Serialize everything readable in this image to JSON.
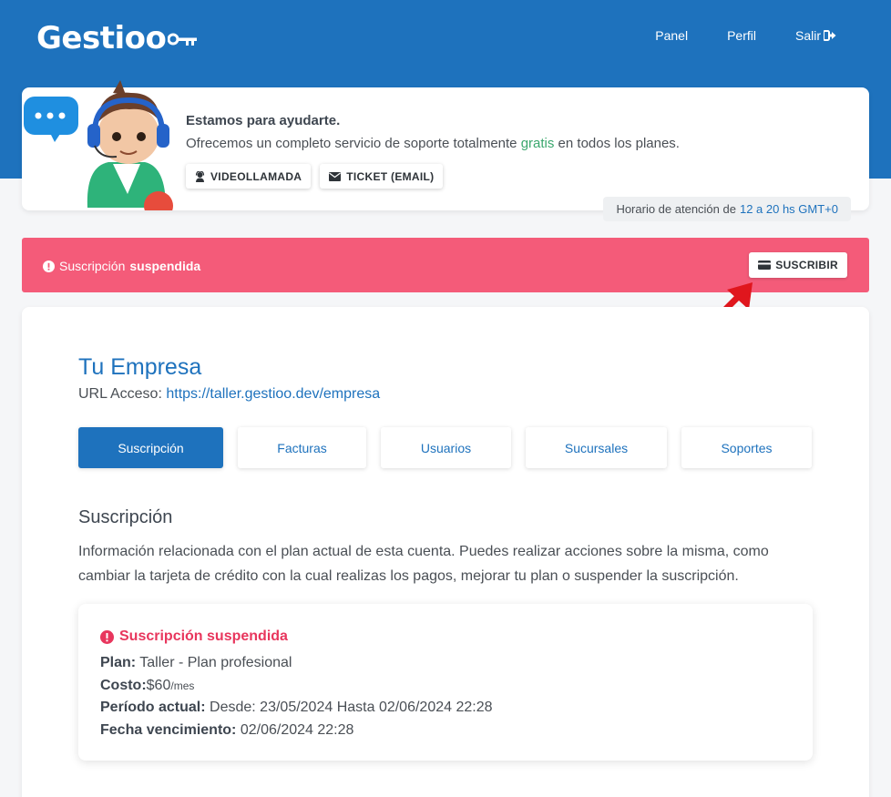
{
  "brand": {
    "logo": "Gestioo"
  },
  "nav": {
    "panel": "Panel",
    "profile": "Perfil",
    "logout": "Salir"
  },
  "help": {
    "title": "Estamos para ayudarte.",
    "desc_before": "Ofrecemos un completo servicio de soporte totalmente",
    "desc_highlight": "gratis",
    "desc_after": "en todos los planes.",
    "video_button": "VIDEOLLAMADA",
    "ticket_button": "TICKET (EMAIL)",
    "hours_label": "Horario de atención de",
    "hours_value": "12 a 20 hs GMT+0"
  },
  "alert": {
    "prefix": "Suscripción",
    "status": "suspendida",
    "subscribe_button": "SUSCRIBIR"
  },
  "company": {
    "name": "Tu Empresa",
    "url_label": "URL Acceso:",
    "url": "https://taller.gestioo.dev/empresa"
  },
  "tabs": [
    "Suscripción",
    "Facturas",
    "Usuarios",
    "Sucursales",
    "Soportes"
  ],
  "section": {
    "title": "Suscripción",
    "desc_line1": "Información relacionada con el plan actual de esta cuenta. Puedes realizar acciones sobre la misma, como",
    "desc_line2": "cambiar la tarjeta de crédito con la cual realizas los pagos, mejorar tu plan o suspender la suscripción."
  },
  "subscription": {
    "status": "Suscripción suspendida",
    "plan_label": "Plan:",
    "plan_value": "Taller - Plan profesional",
    "cost_label": "Costo:",
    "cost_value": "$60",
    "cost_period": "/mes",
    "period_label": "Período actual:",
    "period_value": "Desde: 23/05/2024 Hasta 02/06/2024 22:28",
    "due_label": "Fecha vencimiento:",
    "due_value": "02/06/2024 22:28"
  },
  "colors": {
    "primary": "#1e72bd",
    "alert": "#f45b79",
    "danger_text": "#e8365d",
    "highlight_green": "#3aa76d",
    "arrow": "#e0161d"
  }
}
